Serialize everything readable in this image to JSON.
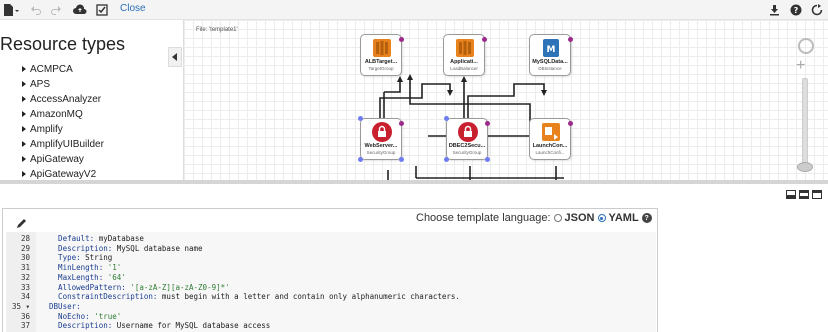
{
  "toolbar": {
    "close_label": "Close",
    "icons_left": [
      "document-icon",
      "undo-icon",
      "redo-icon",
      "cloud-upload-icon",
      "validate-icon"
    ],
    "icons_right": [
      "download-icon",
      "help-icon",
      "refresh-icon"
    ]
  },
  "sidebar": {
    "title": "Resource types",
    "items": [
      "ACMPCA",
      "APS",
      "AccessAnalyzer",
      "AmazonMQ",
      "Amplify",
      "AmplifyUIBuilder",
      "ApiGateway",
      "ApiGatewayV2"
    ]
  },
  "canvas": {
    "file_label": "File: 'template1'",
    "nodes": [
      {
        "name": "ALBTarget...",
        "type": "TargetGroup",
        "icon": "elb-icon"
      },
      {
        "name": "Applicati...",
        "type": "LoadBalancer",
        "icon": "elb-icon"
      },
      {
        "name": "MySQLData...",
        "type": "DBInstance",
        "icon": "rds-icon"
      },
      {
        "name": "WebServer...",
        "type": "SecurityGroup",
        "icon": "security-group-icon"
      },
      {
        "name": "DBEC2Secu...",
        "type": "SecurityGroup",
        "icon": "security-group-icon"
      },
      {
        "name": "LaunchCon...",
        "type": "LaunchConfi...",
        "icon": "launch-config-icon"
      }
    ]
  },
  "editor": {
    "language_prompt": "Choose template language:",
    "lang_json": "JSON",
    "lang_yaml": "YAML",
    "selected_language": "YAML",
    "lines": [
      {
        "num": "28",
        "key": "Default",
        "val": " myDatabase",
        "indent": "    ",
        "str": false
      },
      {
        "num": "29",
        "key": "Description",
        "val": " MySQL database name",
        "indent": "    ",
        "str": false
      },
      {
        "num": "30",
        "key": "Type",
        "val": " String",
        "indent": "    ",
        "str": false
      },
      {
        "num": "31",
        "key": "MinLength",
        "val": " '1'",
        "indent": "    ",
        "str": true
      },
      {
        "num": "32",
        "key": "MaxLength",
        "val": " '64'",
        "indent": "    ",
        "str": true
      },
      {
        "num": "33",
        "key": "AllowedPattern",
        "val": " '[a-zA-Z][a-zA-Z0-9]*'",
        "indent": "    ",
        "str": true
      },
      {
        "num": "34",
        "key": "ConstraintDescription",
        "val": " must begin with a letter and contain only alphanumeric characters.",
        "indent": "    ",
        "str": false
      },
      {
        "num": "35 ▾",
        "key": "DBUser",
        "val": "",
        "indent": "  ",
        "str": false
      },
      {
        "num": "36",
        "key": "NoEcho",
        "val": " 'true'",
        "indent": "    ",
        "str": true
      },
      {
        "num": "37",
        "key": "Description",
        "val": " Username for MySQL database access",
        "indent": "    ",
        "str": false
      }
    ]
  },
  "colors": {
    "link": "#2a6fb5",
    "node_dot_purple": "#9c2a8a",
    "node_dot_blue": "#6f7cf2",
    "elb_orange": "#e8821c",
    "sg_red": "#c8202f",
    "rds_blue": "#2e73b8"
  }
}
